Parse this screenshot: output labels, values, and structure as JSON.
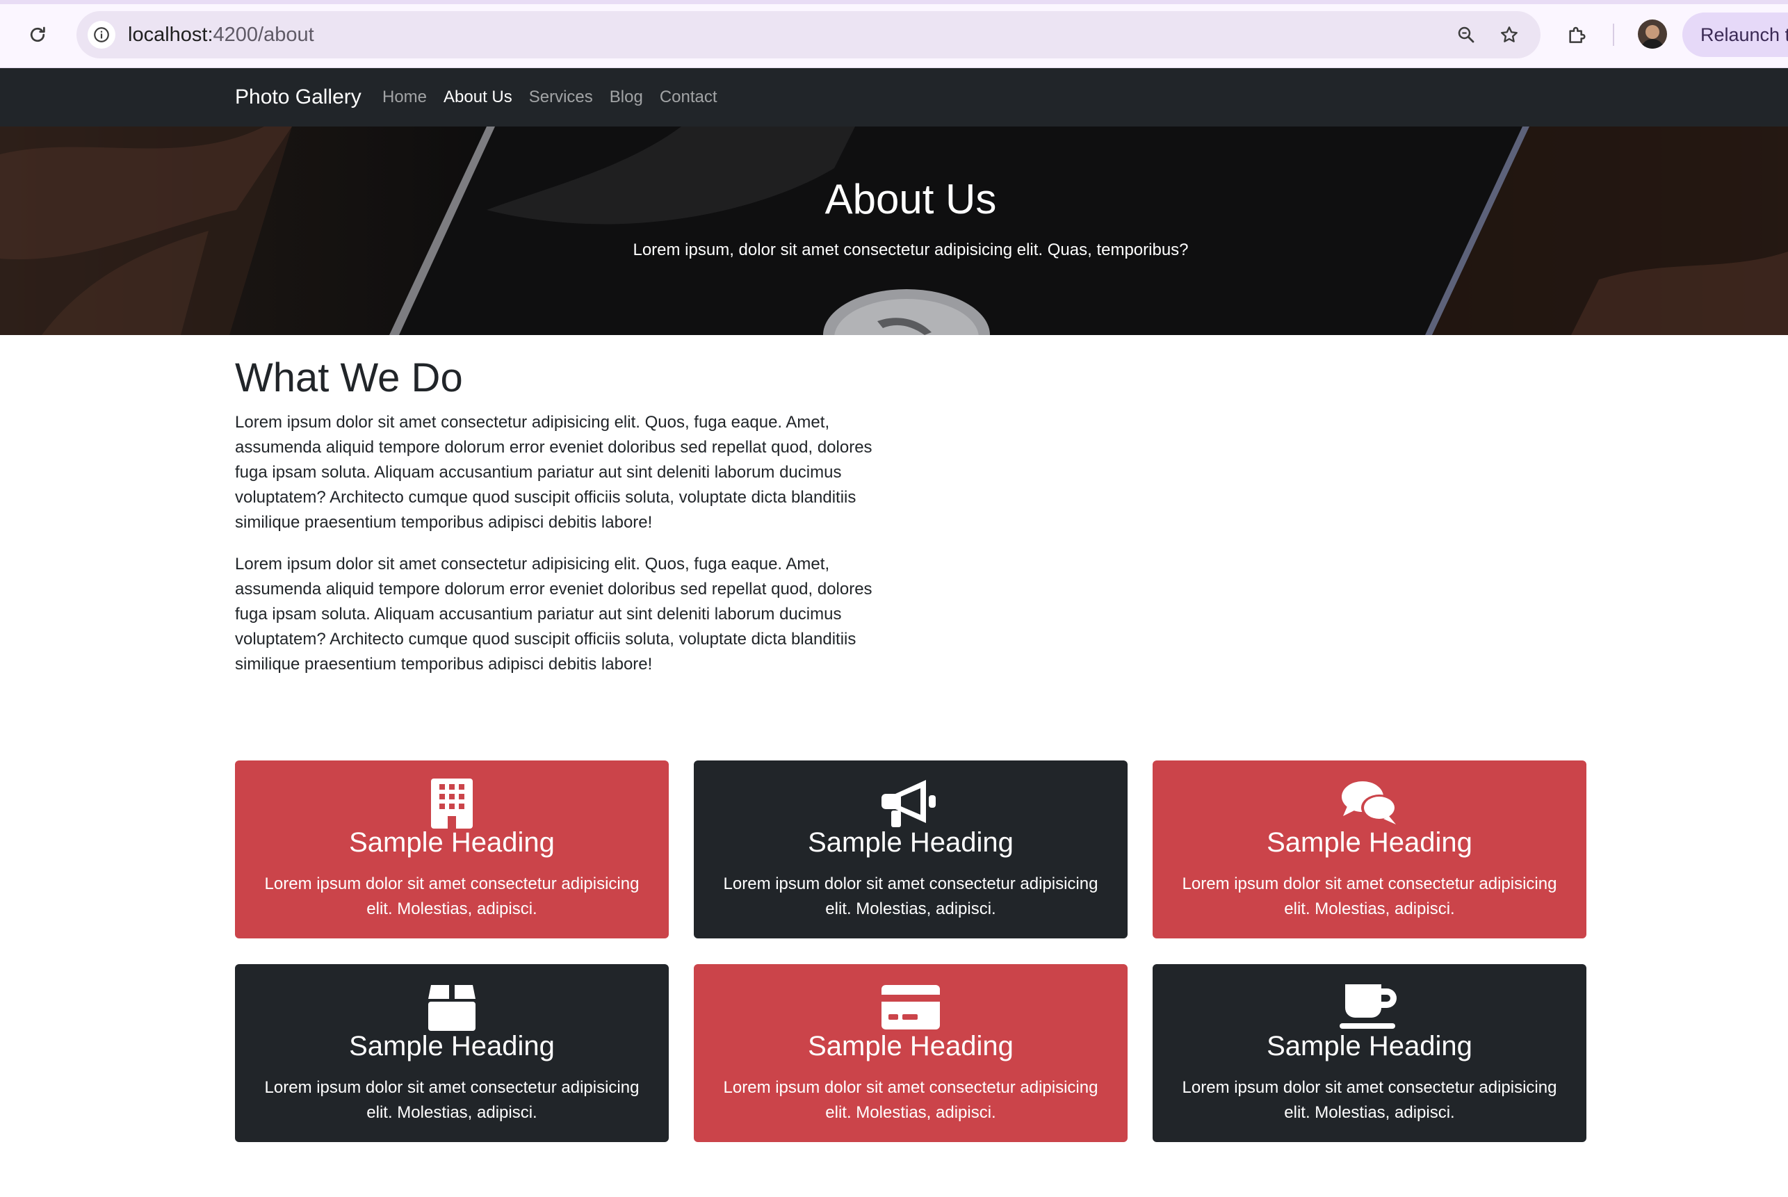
{
  "browser": {
    "url_host": "localhost:",
    "url_path": "4200/about",
    "relaunch_label": "Relaunch t"
  },
  "navbar": {
    "brand": "Photo Gallery",
    "links": [
      {
        "label": "Home",
        "active": false
      },
      {
        "label": "About Us",
        "active": true
      },
      {
        "label": "Services",
        "active": false
      },
      {
        "label": "Blog",
        "active": false
      },
      {
        "label": "Contact",
        "active": false
      }
    ]
  },
  "hero": {
    "title": "About Us",
    "subtitle": "Lorem ipsum, dolor sit amet consectetur adipisicing elit. Quas, temporibus?"
  },
  "what_we_do": {
    "title": "What We Do",
    "paragraphs": [
      "Lorem ipsum dolor sit amet consectetur adipisicing elit. Quos, fuga eaque. Amet, assumenda aliquid tempore dolorum error eveniet doloribus sed repellat quod, dolores fuga ipsam soluta. Aliquam accusantium pariatur aut sint deleniti laborum ducimus voluptatem? Architecto cumque quod suscipit officiis soluta, voluptate dicta blanditiis similique praesentium temporibus adipisci debitis labore!",
      "Lorem ipsum dolor sit amet consectetur adipisicing elit. Quos, fuga eaque. Amet, assumenda aliquid tempore dolorum error eveniet doloribus sed repellat quod, dolores fuga ipsam soluta. Aliquam accusantium pariatur aut sint deleniti laborum ducimus voluptatem? Architecto cumque quod suscipit officiis soluta, voluptate dicta blanditiis similique praesentium temporibus adipisci debitis labore!"
    ]
  },
  "cards": [
    {
      "icon": "building-icon",
      "theme": "red",
      "heading": "Sample Heading",
      "text": "Lorem ipsum dolor sit amet consectetur adipisicing elit. Molestias, adipisci."
    },
    {
      "icon": "megaphone-icon",
      "theme": "dark",
      "heading": "Sample Heading",
      "text": "Lorem ipsum dolor sit amet consectetur adipisicing elit. Molestias, adipisci."
    },
    {
      "icon": "chat-bubbles-icon",
      "theme": "red",
      "heading": "Sample Heading",
      "text": "Lorem ipsum dolor sit amet consectetur adipisicing elit. Molestias, adipisci."
    },
    {
      "icon": "box-icon",
      "theme": "dark",
      "heading": "Sample Heading",
      "text": "Lorem ipsum dolor sit amet consectetur adipisicing elit. Molestias, adipisci."
    },
    {
      "icon": "credit-card-icon",
      "theme": "red",
      "heading": "Sample Heading",
      "text": "Lorem ipsum dolor sit amet consectetur adipisicing elit. Molestias, adipisci."
    },
    {
      "icon": "coffee-cup-icon",
      "theme": "dark",
      "heading": "Sample Heading",
      "text": "Lorem ipsum dolor sit amet consectetur adipisicing elit. Molestias, adipisci."
    }
  ],
  "colors": {
    "card_red": "#cb444a",
    "card_dark": "#212529",
    "navbar": "#212529"
  }
}
